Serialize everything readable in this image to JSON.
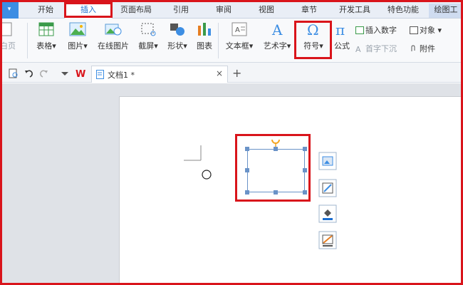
{
  "tabs": {
    "start": "开始",
    "insert": "插入",
    "page_layout": "页面布局",
    "references": "引用",
    "review": "审阅",
    "view": "视图",
    "section": "章节",
    "developer": "开发工具",
    "special": "特色功能",
    "drawing_tools": "绘图工"
  },
  "ribbon": {
    "blank_page": "白页",
    "table": "表格",
    "picture": "图片",
    "online_picture": "在线图片",
    "screenshot": "截屏",
    "shapes": "形状",
    "chart": "图表",
    "textbox": "文本框",
    "wordart": "艺术字",
    "symbol": "符号",
    "formula": "公式",
    "insert_number": "插入数字",
    "object": "对象",
    "drop_cap": "首字下沉",
    "attachment": "附件"
  },
  "document": {
    "tab_name": "文档1 *",
    "close_glyph": "×",
    "new_tab_glyph": "+",
    "wps_logo": "W"
  },
  "colors": {
    "accent": "#1c6fd1",
    "highlight": "#d9141b",
    "selection": "#6a93c8",
    "rotate_handle": "#f5a623",
    "wps_red": "#d9141b"
  }
}
